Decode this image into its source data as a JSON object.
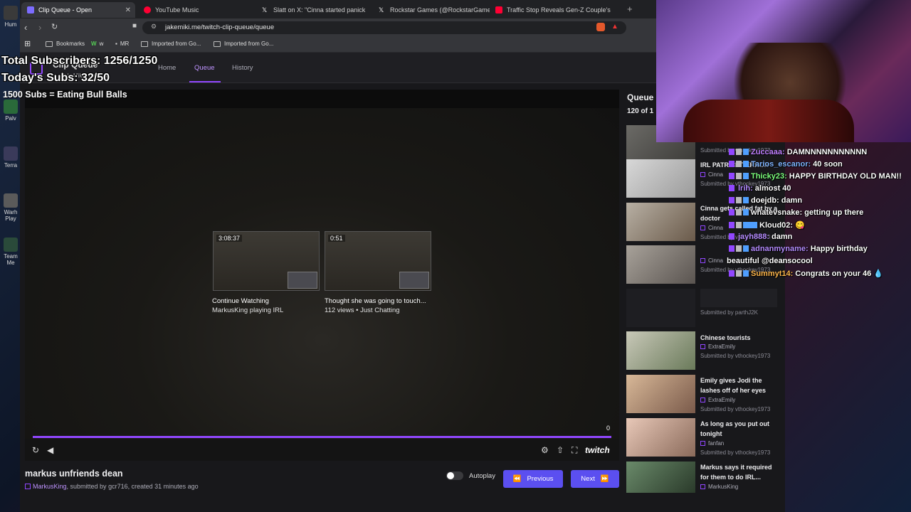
{
  "desktop": {
    "icons": [
      {
        "label": "Hum"
      },
      {
        "label": "Palv"
      },
      {
        "label": "Terra"
      },
      {
        "label": "Warh Play"
      },
      {
        "label": "Team Me"
      }
    ]
  },
  "browser": {
    "tabs": [
      {
        "label": "Clip Queue - Open",
        "color": "#7c6cff",
        "active": true
      },
      {
        "label": "YouTube Music",
        "color": "#ff0033",
        "active": false
      },
      {
        "label": "Slatt on X: \"Cinna started panick",
        "color": "#ffffff",
        "active": false
      },
      {
        "label": "Rockstar Games (@RockstarGames) /",
        "color": "#ffffff",
        "active": false
      },
      {
        "label": "Traffic Stop Reveals Gen-Z Couple's",
        "color": "#ff0033",
        "active": false
      }
    ],
    "url": "jakemiki.me/twitch-clip-queue/queue",
    "bookmarks": [
      {
        "label": "Bookmarks"
      },
      {
        "label": "w"
      },
      {
        "label": "MR"
      },
      {
        "label": "Imported from Go..."
      },
      {
        "label": "Imported from Go..."
      }
    ]
  },
  "site": {
    "title": "Clip Queue",
    "subtitle": "JakeMiki • Muffin9",
    "nav": [
      {
        "label": "Home",
        "active": false
      },
      {
        "label": "Queue",
        "active": true
      },
      {
        "label": "History",
        "active": false
      }
    ]
  },
  "player": {
    "suggestions": [
      {
        "duration": "3:08:37",
        "title": "Continue Watching",
        "sub": "MarkusKing playing IRL"
      },
      {
        "duration": "0:51",
        "title": "Thought she was going to touch...",
        "sub": "112 views • Just Chatting"
      }
    ],
    "time": "0",
    "progress": 1.0,
    "twitch_label": "twitch"
  },
  "clip": {
    "title": "markus unfriends dean",
    "channel": "MarkusKing",
    "submitted_by_prefix": ", submitted by ",
    "submitter": "gcr716",
    "created": ", created 31 minutes ago"
  },
  "controls": {
    "autoplay_label": "Autoplay",
    "previous_label": "Previous",
    "next_label": "Next"
  },
  "queue": {
    "heading": "Queue",
    "count": "120 of 1",
    "items": [
      {
        "title": "",
        "channel": "",
        "submitted": "Submitted by vthockey1973"
      },
      {
        "title": "IRL PATRICK TERROR",
        "channel": "Cinna",
        "submitted": "Submitted by vthockey1973"
      },
      {
        "title": "Cinna gets called fat by a doctor",
        "channel": "Cinna",
        "submitted": "Submitted by vthockey1973"
      },
      {
        "title": "",
        "channel": "Cinna",
        "submitted": "Submitted by vthockey1973"
      },
      {
        "title": "",
        "channel": "",
        "submitted": "Submitted by parthJ2K"
      },
      {
        "title": "Chinese tourists",
        "channel": "ExtraEmily",
        "submitted": "Submitted by vthockey1973"
      },
      {
        "title": "Emily gives Jodi the lashes off of her eyes",
        "channel": "ExtraEmily",
        "submitted": "Submitted by vthockey1973"
      },
      {
        "title": "As long as you put out tonight",
        "channel": "fanfan",
        "submitted": "Submitted by vthockey1973"
      },
      {
        "title": "Markus says it required for them to do IRL...",
        "channel": "MarkusKing",
        "submitted": ""
      }
    ]
  },
  "overlay": {
    "total_subs": "Total Subscribers: 1256/1250",
    "today_subs": "Today's Subs: 32/50",
    "goal": "1500 Subs = Eating Bull Balls"
  },
  "chat": [
    {
      "user": "Zuccaaa:",
      "color": "#c080ff",
      "msg": "DAMNNNNNNNNNNN"
    },
    {
      "user": "Tarios_escanor:",
      "color": "#7fb4ff",
      "msg": "40 soon"
    },
    {
      "user": "Thicky23:",
      "color": "#7dff7d",
      "msg": "HAPPY BIRTHDAY OLD MAN!!"
    },
    {
      "user": "lrih:",
      "color": "#b58cff",
      "msg": "almost 40"
    },
    {
      "user": "doejdb:",
      "color": "#ffffff",
      "msg": "damn"
    },
    {
      "user": "whatevsnake:",
      "color": "#ffffff",
      "msg": "getting up there"
    },
    {
      "user": "Kloud02:",
      "color": "#ffffff",
      "msg": "😋"
    },
    {
      "user": "jayh888:",
      "color": "#b58cff",
      "msg": "damn"
    },
    {
      "user": "adnanmyname:",
      "color": "#b58cff",
      "msg": "Happy birthday"
    },
    {
      "user": "",
      "color": "#ffffff",
      "msg": "beautiful @deansocool"
    },
    {
      "user": "Summyt14:",
      "color": "#ffb84d",
      "msg": "Congrats on your 46 💧"
    }
  ]
}
